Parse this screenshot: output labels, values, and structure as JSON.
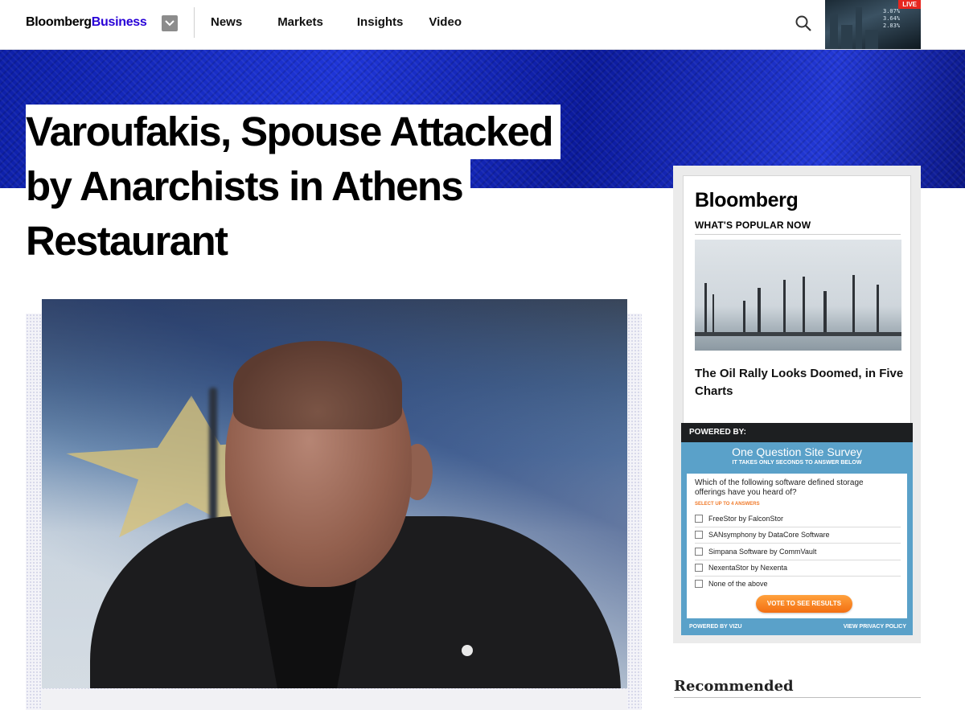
{
  "header": {
    "logo_part1": "Bloomberg",
    "logo_part2": "Business",
    "nav": [
      "News",
      "Markets",
      "Insights",
      "Video"
    ],
    "live_badge": "LIVE",
    "ticker": [
      "3.07%",
      "3.64%",
      "2.83%"
    ]
  },
  "article": {
    "headline_lines": [
      "Varoufakis, Spouse Attacked",
      "by Anarchists in Athens",
      "Restaurant"
    ]
  },
  "popular": {
    "brand": "Bloomberg",
    "subtitle": "WHAT'S POPULAR NOW",
    "headline": "The Oil Rally Looks Doomed, in Five Charts"
  },
  "survey": {
    "powered_by_header": "POWERED BY:",
    "title": "One Question Site Survey",
    "subtitle": "IT TAKES ONLY SECONDS TO ANSWER BELOW",
    "question": "Which of the following software defined storage offerings have you heard of?",
    "hint": "SELECT UP TO 4 ANSWERS",
    "options": [
      "FreeStor by FalconStor",
      "SANsymphony by DataCore Software",
      "Simpana Software by CommVault",
      "NexentaStor by Nexenta",
      "None of the above"
    ],
    "vote_label": "VOTE TO SEE RESULTS",
    "footer_left": "POWERED BY VIZU",
    "footer_right": "VIEW PRIVACY POLICY"
  },
  "recommended": {
    "title": "Recommended"
  },
  "colors": {
    "brand_blue": "#2800d7",
    "hero_blue": "#1e35d8",
    "survey_blue": "#5aa1c9",
    "vote_orange": "#f36f12",
    "live_red": "#e7261f"
  }
}
